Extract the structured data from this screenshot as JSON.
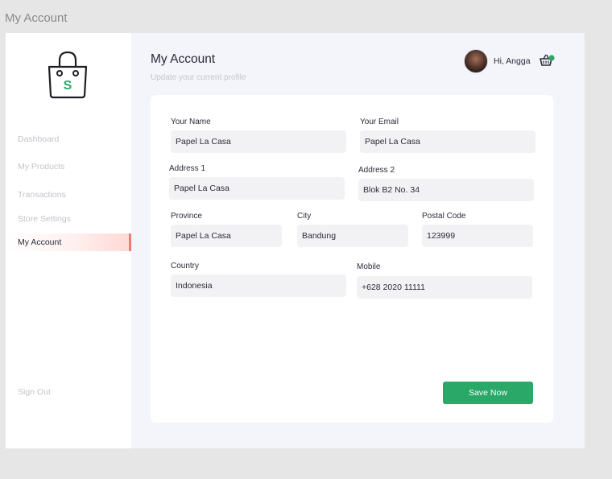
{
  "window": {
    "title": "My Account"
  },
  "sidebar": {
    "items": [
      {
        "label": "Dashboard"
      },
      {
        "label": "My Products"
      },
      {
        "label": "Transactions"
      },
      {
        "label": "Store Settings"
      },
      {
        "label": "My Account"
      }
    ],
    "sign_out": "Sign Out",
    "logo_letter": "S"
  },
  "header": {
    "title": "My Account",
    "subtitle": "Update your current profile",
    "greeting": "Hi, Angga"
  },
  "form": {
    "name": {
      "label": "Your Name",
      "value": "Papel La Casa"
    },
    "email": {
      "label": "Your Email",
      "value": "Papel La Casa"
    },
    "address1": {
      "label": "Address 1",
      "value": "Papel La Casa"
    },
    "address2": {
      "label": "Address 2",
      "value": "Blok B2 No. 34"
    },
    "province": {
      "label": "Province",
      "value": "Papel La Casa"
    },
    "city": {
      "label": "City",
      "value": "Bandung"
    },
    "postal": {
      "label": "Postal Code",
      "value": "123999"
    },
    "country": {
      "label": "Country",
      "value": "Indonesia"
    },
    "mobile": {
      "label": "Mobile",
      "value": "+628 2020 11111"
    },
    "save_label": "Save Now"
  },
  "colors": {
    "accent_green": "#29a867",
    "active_indicator": "#f07d74",
    "background": "#f4f4fb"
  },
  "icons": {
    "logo": "shopping-bag-icon",
    "cart": "shopping-basket-icon"
  }
}
